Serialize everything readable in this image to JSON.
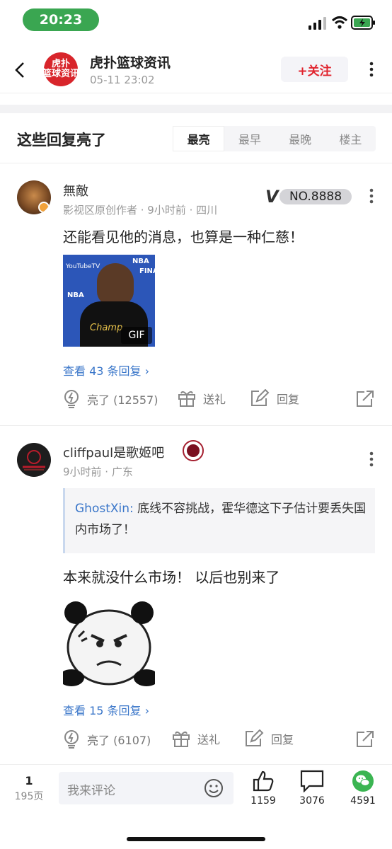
{
  "status_bar": {
    "time": "20:23"
  },
  "header": {
    "avatar_text": "虎扑\n篮球资讯",
    "title": "虎扑篮球资讯",
    "date": "05-11 23:02",
    "follow_label": "+关注"
  },
  "section": {
    "title": "这些回复亮了",
    "tabs": [
      "最亮",
      "最早",
      "最晚",
      "楼主"
    ]
  },
  "comments": [
    {
      "username": "無敵",
      "meta": "影视区原创作者 · 9小时前 · 四川",
      "badge": "NO.8888",
      "text": "还能看见他的消息，也算是一种仁慈！",
      "image_badge": "GIF",
      "image_caption_1": "YouTubeTV",
      "image_caption_2": "NBA",
      "image_caption_3": "FINA",
      "image_caption_4": "Champ",
      "replies": "查看 43 条回复",
      "like": "亮了 (12557)",
      "gift": "送礼",
      "reply": "回复"
    },
    {
      "username": "cliffpaul是歌姬吧",
      "meta": "9小时前 · 广东",
      "quote_user": "GhostXin:",
      "quote_text": " 底线不容挑战，霍华德这下子估计要丢失国内市场了！",
      "text": "本来就没什么市场！ 以后也别来了",
      "replies": "查看 15 条回复",
      "like": "亮了 (6107)",
      "gift": "送礼",
      "reply": "回复"
    }
  ],
  "bottom_bar": {
    "page_current": "1",
    "page_total": "195页",
    "input_placeholder": "我来评论",
    "likes": "1159",
    "comments": "3076",
    "shares": "4591"
  },
  "colors": {
    "accent_red": "#e1252f",
    "link_blue": "#3a76c9",
    "status_green": "#3aa651",
    "wechat_green": "#3bb552"
  }
}
